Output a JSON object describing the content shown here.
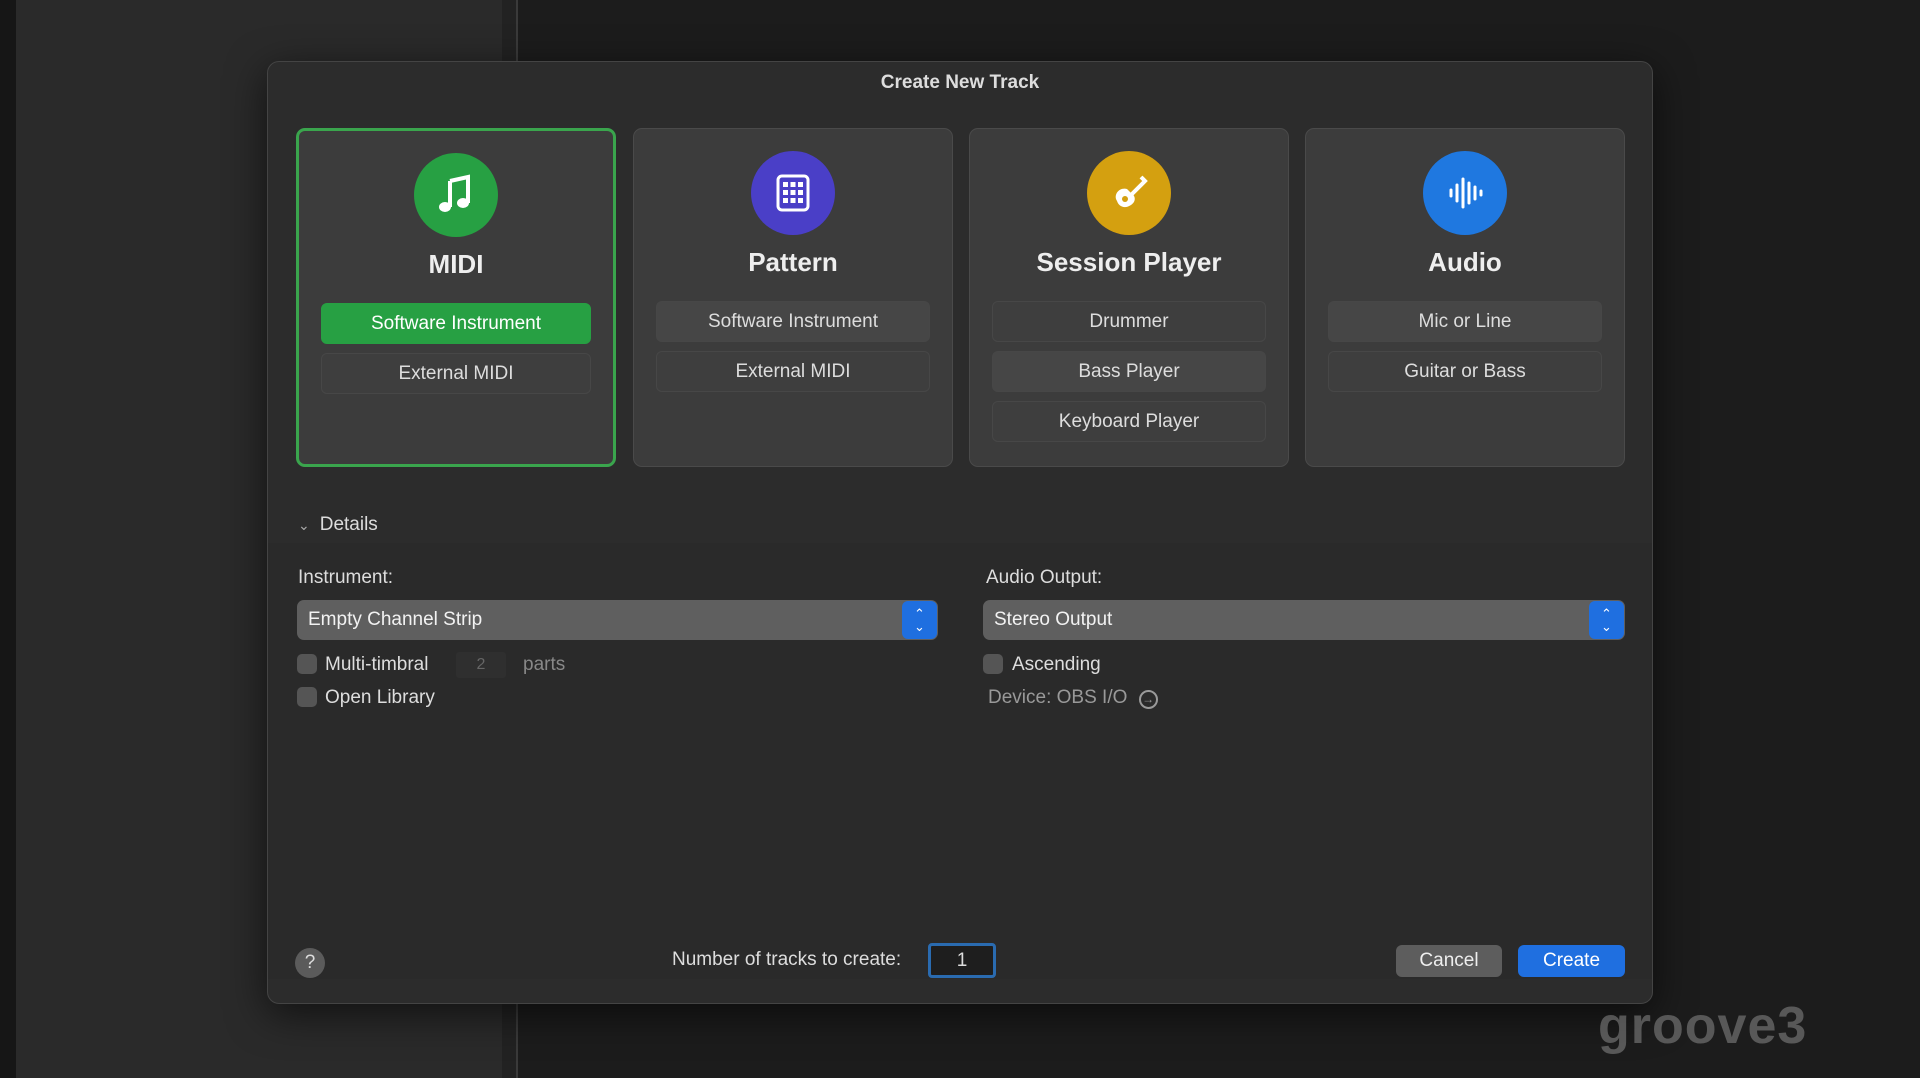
{
  "dialog": {
    "title": "Create New Track"
  },
  "cards": [
    {
      "title": "MIDI",
      "icon": "music-note-icon",
      "color": "#27a043",
      "options": [
        "Software Instrument",
        "External MIDI"
      ],
      "selected": true
    },
    {
      "title": "Pattern",
      "icon": "grid-pad-icon",
      "color": "#4a3fc7",
      "options": [
        "Software Instrument",
        "External MIDI"
      ]
    },
    {
      "title": "Session Player",
      "icon": "guitar-icon",
      "color": "#d4a010",
      "options": [
        "Drummer",
        "Bass Player",
        "Keyboard Player"
      ]
    },
    {
      "title": "Audio",
      "icon": "waveform-icon",
      "color": "#1f78e0",
      "options": [
        "Mic or Line",
        "Guitar or Bass"
      ]
    }
  ],
  "details": {
    "label": "Details",
    "instrument_label": "Instrument:",
    "instrument_value": "Empty Channel Strip",
    "multitimbral": "Multi-timbral",
    "parts_value": "2",
    "parts_label": "parts",
    "open_library": "Open Library",
    "audio_output_label": "Audio Output:",
    "audio_output_value": "Stereo Output",
    "ascending": "Ascending",
    "device": "Device: OBS I/O"
  },
  "footer": {
    "help": "?",
    "tracks_label": "Number of tracks to create:",
    "tracks_value": "1",
    "cancel": "Cancel",
    "create": "Create"
  },
  "watermark": "groove3"
}
